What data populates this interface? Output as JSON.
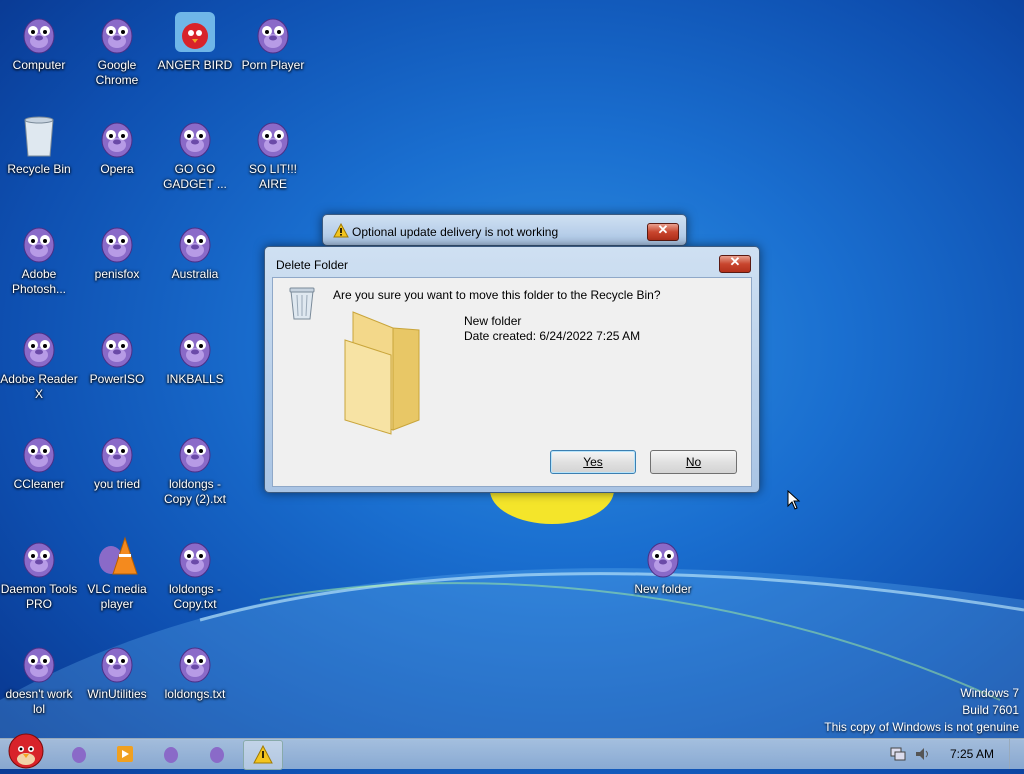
{
  "desktop": {
    "icons": [
      {
        "label": "Computer"
      },
      {
        "label": "Google Chrome"
      },
      {
        "label": "ANGER BIRD"
      },
      {
        "label": "Porn Player"
      },
      {
        "label": "Recycle Bin"
      },
      {
        "label": "Opera"
      },
      {
        "label": "GO GO GADGET ..."
      },
      {
        "label": "SO LIT!!! AIRE"
      },
      {
        "label": "Adobe Photosh..."
      },
      {
        "label": "penisfox"
      },
      {
        "label": "Australia"
      },
      {
        "label": "Adobe Reader X"
      },
      {
        "label": "PowerISO"
      },
      {
        "label": "INKBALLS"
      },
      {
        "label": "CCleaner"
      },
      {
        "label": "you tried"
      },
      {
        "label": "loldongs - Copy (2).txt"
      },
      {
        "label": "Daemon Tools PRO"
      },
      {
        "label": "VLC media player"
      },
      {
        "label": "loldongs - Copy.txt"
      },
      {
        "label": "doesn't work lol"
      },
      {
        "label": "WinUtilities"
      },
      {
        "label": "loldongs.txt"
      },
      {
        "label": "New folder"
      }
    ]
  },
  "update_window": {
    "title": "Optional update delivery is not working"
  },
  "dialog": {
    "title": "Delete Folder",
    "question": "Are you sure you want to move this folder to the Recycle Bin?",
    "item_name": "New folder",
    "item_date": "Date created: 6/24/2022 7:25 AM",
    "yes_label": "Yes",
    "no_label": "No"
  },
  "watermark": {
    "line1": "Windows 7",
    "line2": "Build 7601",
    "line3": "This copy of Windows is not genuine"
  },
  "taskbar": {
    "clock": "7:25 AM"
  },
  "colors": {
    "accent": "#1a6fd0",
    "icon_purple": "#8a6ac8"
  }
}
